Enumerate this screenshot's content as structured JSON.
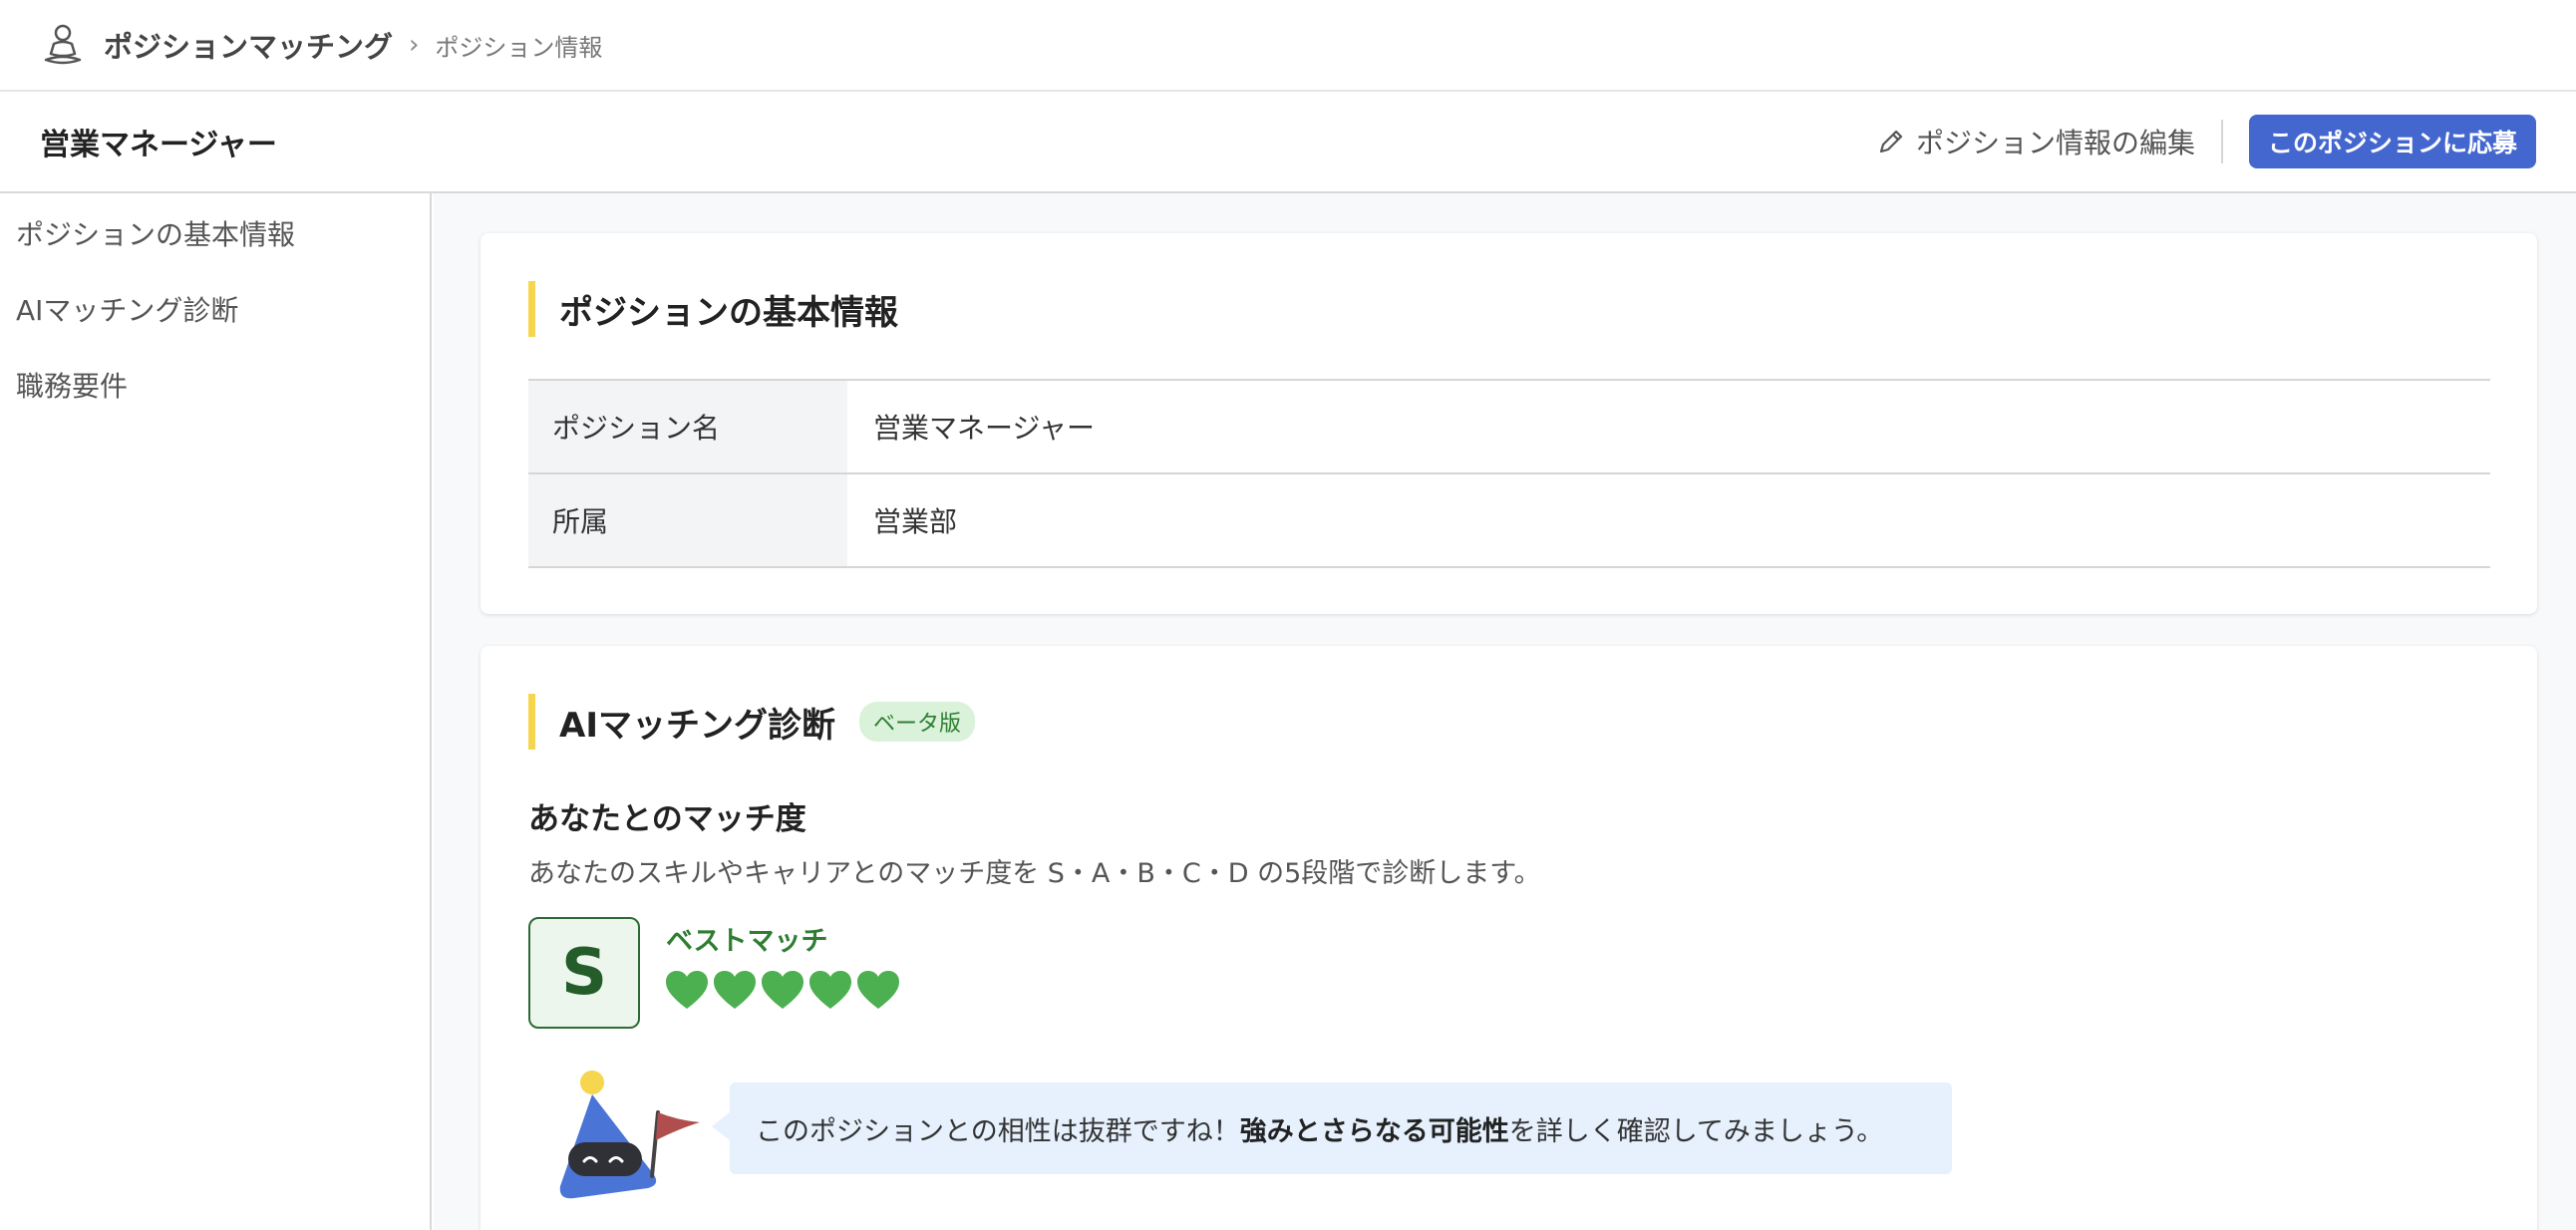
{
  "header": {
    "app_name": "ポジションマッチング",
    "breadcrumb_separator": "›",
    "breadcrumb_current": "ポジション情報"
  },
  "subheader": {
    "position_title": "営業マネージャー",
    "edit_label": "ポジション情報の編集",
    "apply_label": "このポジションに応募"
  },
  "sidebar": {
    "items": [
      {
        "label": "ポジションの基本情報"
      },
      {
        "label": "AIマッチング診断"
      },
      {
        "label": "職務要件"
      }
    ]
  },
  "basic_info": {
    "title": "ポジションの基本情報",
    "rows": [
      {
        "label": "ポジション名",
        "value": "営業マネージャー"
      },
      {
        "label": "所属",
        "value": "営業部"
      }
    ]
  },
  "ai_matching": {
    "title": "AIマッチング診断",
    "badge": "ベータ版",
    "match_heading": "あなたとのマッチ度",
    "match_description": "あなたのスキルやキャリアとのマッチ度を S・A・B・C・D の5段階で診断します。",
    "grade": "S",
    "grade_label": "ベストマッチ",
    "hearts_filled": 5,
    "hearts_total": 5,
    "message_before": "このポジションとの相性は抜群ですね！",
    "message_bold": "強みとさらなる可能性",
    "message_after": "を詳しく確認してみましょう。"
  },
  "colors": {
    "primary": "#4467cf",
    "accent_bar": "#f5d64e",
    "grade_green": "#2e7d32",
    "heart_green": "#4caf50",
    "bubble_bg": "#e6f1fd"
  },
  "icons": {
    "app": "person-meditation-icon",
    "edit": "pencil-icon",
    "heart": "heart-icon",
    "mascot": "robot-mascot-with-flag"
  }
}
